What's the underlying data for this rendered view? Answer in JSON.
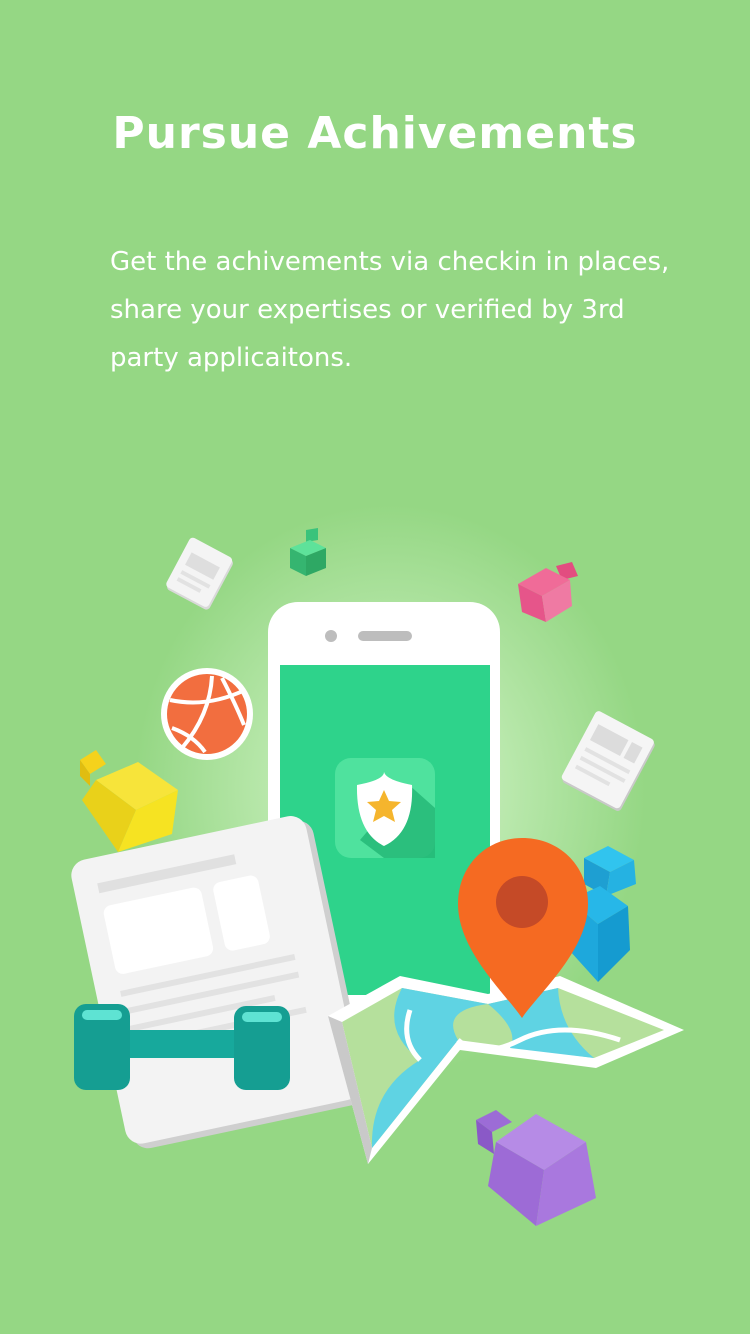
{
  "onboarding": {
    "title": "Pursue Achivements",
    "description": "Get the achivements via checkin in places, share your expertises or verified by 3rd party applicaitons."
  },
  "colors": {
    "background": "#95d784",
    "phone_screen": "#2ed38b",
    "map_pin": "#f56a22",
    "dumbbell": "#17a99c",
    "basketball": "#f26e3f"
  },
  "illustration": {
    "icons": [
      "document-icon",
      "green-cube-icon",
      "pink-cube-icon",
      "basketball-icon",
      "yellow-cube-icon",
      "smartphone-icon",
      "badge-app-icon",
      "newspaper-icon",
      "blue-cube-icon",
      "map-pin-icon",
      "map-icon",
      "dumbbell-icon",
      "purple-cube-icon"
    ]
  }
}
